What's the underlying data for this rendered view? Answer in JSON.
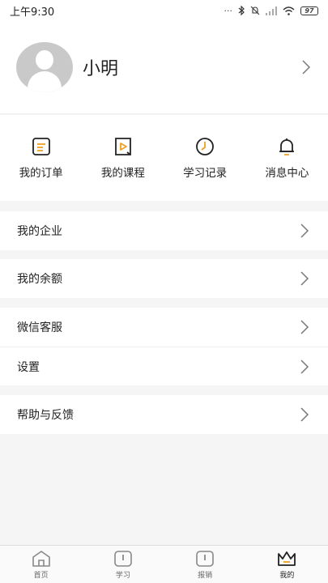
{
  "status_bar": {
    "time": "上午9:30",
    "battery": "97"
  },
  "profile": {
    "name": "小明"
  },
  "shortcuts": [
    {
      "label": "我的订单",
      "icon": "order-icon"
    },
    {
      "label": "我的课程",
      "icon": "course-icon"
    },
    {
      "label": "学习记录",
      "icon": "study-record-icon"
    },
    {
      "label": "消息中心",
      "icon": "bell-icon"
    }
  ],
  "menu": {
    "enterprise": "我的企业",
    "balance": "我的余额",
    "wechat_service": "微信客服",
    "settings": "设置",
    "help_feedback": "帮助与反馈"
  },
  "tabbar": [
    {
      "label": "首页",
      "icon": "home-icon"
    },
    {
      "label": "学习",
      "icon": "study-icon"
    },
    {
      "label": "报销",
      "icon": "reimburse-icon"
    },
    {
      "label": "我的",
      "icon": "crown-icon",
      "active": true
    }
  ],
  "colors": {
    "accent": "#f0a020",
    "background": "#f5f5f5"
  }
}
